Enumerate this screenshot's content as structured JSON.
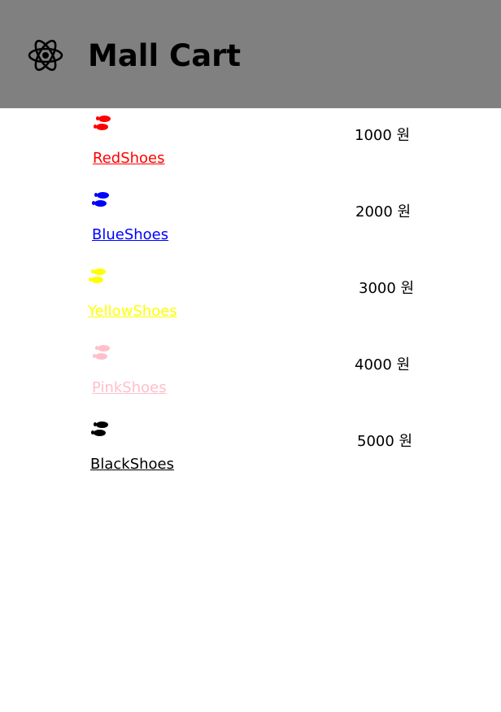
{
  "header": {
    "title": "Mall Cart",
    "logo_icon": "react-atom-icon",
    "background_color": "#808080"
  },
  "products": [
    {
      "name": "RedShoes",
      "price": "1000 원",
      "color": "#ff0000",
      "icon": "footprints-icon"
    },
    {
      "name": "BlueShoes",
      "price": "2000 원",
      "color": "#0000ff",
      "icon": "footprints-icon"
    },
    {
      "name": "YellowShoes",
      "price": "3000 원",
      "color": "#ffff00",
      "icon": "footprints-icon"
    },
    {
      "name": "PinkShoes",
      "price": "4000 원",
      "color": "#ffc0cb",
      "icon": "footprints-icon"
    },
    {
      "name": "BlackShoes",
      "price": "5000 원",
      "color": "#000000",
      "icon": "footprints-icon"
    }
  ]
}
